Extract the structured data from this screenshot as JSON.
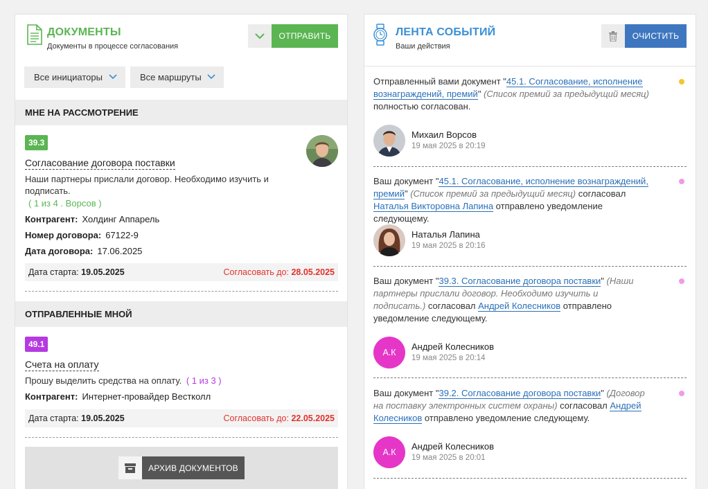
{
  "documents": {
    "title": "ДОКУМЕНТЫ",
    "subtitle": "Документы в процессе согласования",
    "send_label": "ОТПРАВИТЬ",
    "filters": {
      "initiators": "Все инициаторы",
      "routes": "Все маршруты"
    },
    "review_section": {
      "title": "МНЕ НА РАССМОТРЕНИЕ",
      "card": {
        "badge": "39.3",
        "badge_color": "#5ab552",
        "title": "Согласование договора поставки",
        "description": "Наши партнеры прислали договор. Необходимо изучить и подписать.",
        "progress": "( 1 из 4 . Ворсов )",
        "fields": [
          {
            "label": "Контрагент:",
            "value": "Холдинг Аппарель"
          },
          {
            "label": "Номер договора:",
            "value": "67122-9"
          },
          {
            "label": "Дата договора:",
            "value": "17.06.2025"
          }
        ],
        "start_label": "Дата старта:",
        "start_date": "19.05.2025",
        "deadline_label": "Согласовать до:",
        "deadline": "28.05.2025"
      }
    },
    "sent_section": {
      "title": "ОТПРАВЛЕННЫЕ МНОЙ",
      "card": {
        "badge": "49.1",
        "badge_color": "#b53ae0",
        "title": "Счета на оплату",
        "description": "Прошу выделить средства на оплату.",
        "progress": "( 1 из 3 )",
        "fields": [
          {
            "label": "Контрагент:",
            "value": "Интернет-провайдер Вестколл"
          }
        ],
        "start_label": "Дата старта:",
        "start_date": "19.05.2025",
        "deadline_label": "Согласовать до:",
        "deadline": "22.05.2025"
      }
    },
    "archive_label": "АРХИВ ДОКУМЕНТОВ"
  },
  "feed": {
    "title": "ЛЕНТА СОБЫТИЙ",
    "subtitle": "Ваши действия",
    "clear_label": "ОЧИСТИТЬ",
    "events": [
      {
        "t1": "Отправленный вами документ \"",
        "link": "45.1. Согласование, исполнение вознаграждений, премий",
        "t2": "\" ",
        "note": "(Список премий за предыдущий месяц)",
        "t3": " полностью согласован.",
        "person_link": "",
        "t4": "",
        "dot_color": "#f2c531",
        "author": "Михаил Ворсов",
        "time": "19 мая 2025 в 20:19",
        "initials": ""
      },
      {
        "t1": "Ваш документ \"",
        "link": "45.1. Согласование, исполнение вознаграждений, премий",
        "t2": "\" ",
        "note": "(Список премий за предыдущий месяц)",
        "t3": " согласовал ",
        "person_link": "Наталья Викторовна Лапина",
        "t4": " отправлено уведомление следующему.",
        "dot_color": "#ef9be6",
        "author": "Наталья Лапина",
        "time": "19 мая 2025 в 20:16",
        "initials": ""
      },
      {
        "t1": "Ваш документ \"",
        "link": "39.3. Согласование договора поставки",
        "t2": "\" ",
        "note": "(Наши партнеры прислали договор. Необходимо изучить и подписать.)",
        "t3": " согласовал ",
        "person_link": "Андрей Колесников",
        "t4": " отправлено уведомление следующему.",
        "dot_color": "#ef9be6",
        "author": "Андрей Колесников",
        "time": "19 мая 2025 в 20:14",
        "initials": "А.К"
      },
      {
        "t1": "Ваш документ \"",
        "link": "39.2. Согласование договора поставки",
        "t2": "\" ",
        "note": "(Договор на поставку электронных систем охраны)",
        "t3": " согласовал ",
        "person_link": "Андрей Колесников",
        "t4": " отправлено уведомление следующему.",
        "dot_color": "#ef9be6",
        "author": "Андрей Колесников",
        "time": "19 мая 2025 в 20:01",
        "initials": "А.К"
      }
    ]
  }
}
